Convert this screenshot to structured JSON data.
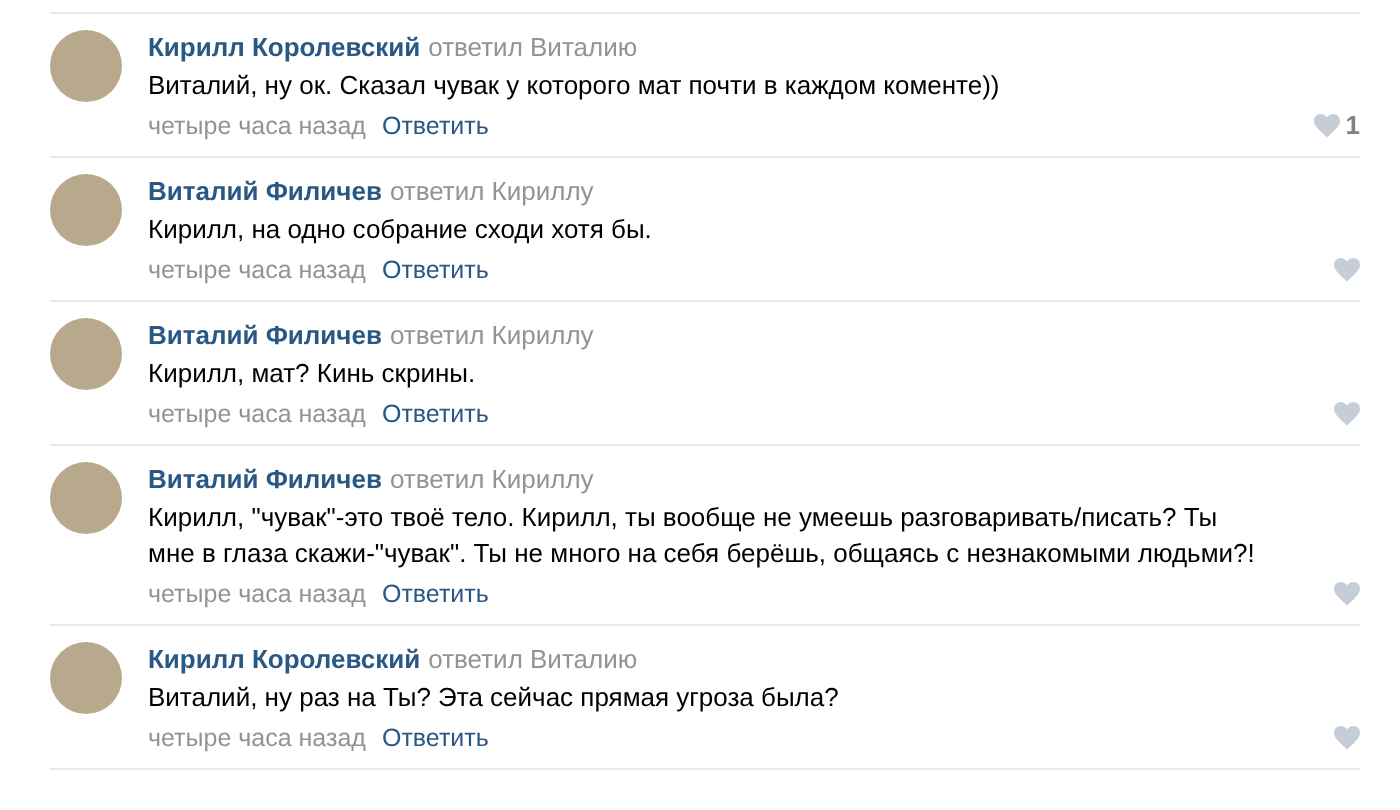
{
  "comments": [
    {
      "author": "Кирилл Королевский",
      "reply_to": "ответил Виталию",
      "text": "Виталий, ну ок. Сказал чувак у которого мат почти в каждом коменте))",
      "time": "четыре часа назад",
      "reply": "Ответить",
      "likes": "1"
    },
    {
      "author": "Виталий Филичев",
      "reply_to": "ответил Кириллу",
      "text": "Кирилл, на одно собрание сходи хотя бы.",
      "time": "четыре часа назад",
      "reply": "Ответить"
    },
    {
      "author": "Виталий Филичев",
      "reply_to": "ответил Кириллу",
      "text": "Кирилл, мат? Кинь скрины.",
      "time": "четыре часа назад",
      "reply": "Ответить"
    },
    {
      "author": "Виталий Филичев",
      "reply_to": "ответил Кириллу",
      "text": "Кирилл, \"чувак\"-это твоё тело. Кирилл, ты вообще не умеешь разговаривать/писать? Ты мне в глаза скажи-\"чувак\". Ты не много на себя берёшь, общаясь с незнакомыми людьми?!",
      "time": "четыре часа назад",
      "reply": "Ответить"
    },
    {
      "author": "Кирилл Королевский",
      "reply_to": "ответил Виталию",
      "text": "Виталий, ну раз на Ты? Эта сейчас прямая угроза была?",
      "time": "четыре часа назад",
      "reply": "Ответить"
    }
  ]
}
